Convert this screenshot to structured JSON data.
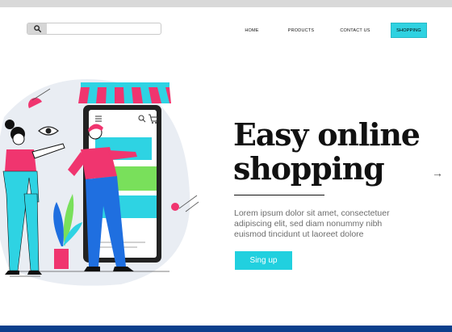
{
  "header": {
    "search": {
      "icon": "search-icon",
      "value": "",
      "placeholder": ""
    },
    "nav": [
      {
        "label": "HOME"
      },
      {
        "label": "PRODUCTS"
      },
      {
        "label": "CONTACT US"
      },
      {
        "label": "SHOPPING",
        "active": true
      }
    ]
  },
  "hero": {
    "title_line1": "Easy online",
    "title_line2": "shopping",
    "body": "Lorem ipsum dolor sit amet, consectetuer adipiscing elit, sed diam nonummy nibh euismod tincidunt ut laoreet dolore",
    "cta_label": "Sing up",
    "next_icon": "arrow-right-icon"
  },
  "colors": {
    "accent": "#21d0df",
    "footer_bar": "#0b3f8c",
    "top_bar": "#d9d9d9",
    "pink": "#f0356f",
    "blue": "#1f6fe0",
    "green": "#79e05b"
  }
}
